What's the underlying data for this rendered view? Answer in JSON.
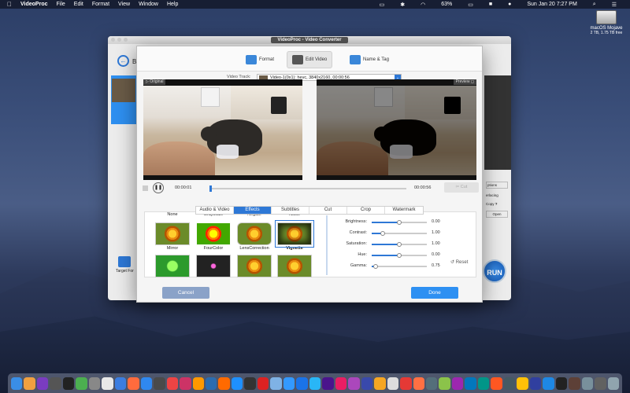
{
  "menubar": {
    "app": "VideoProc",
    "items": [
      "File",
      "Edit",
      "Format",
      "View",
      "Window",
      "Help"
    ],
    "battery": "63%",
    "datetime": "Sun Jan 20  7:27 PM"
  },
  "desktop": {
    "drive_name": "macOS Mojave",
    "drive_info": "2 TB, 1.75 TB free"
  },
  "back_window": {
    "title": "VideoProc - Video Converter",
    "back_letter": "B",
    "options_label": "ptions",
    "deinterlacing": "erlacing",
    "copy_label": "Copy",
    "help": "?",
    "open_label": "Open",
    "run_label": "RUN",
    "target_label": "Target For"
  },
  "dialog": {
    "tabs": [
      "Format",
      "Edit Video",
      "Name & Tag"
    ],
    "video_track_label": "Video Track:",
    "video_track_value": "Video-1(0x1): hevc, 3840x2160, 00:00:56",
    "original_label": "Original",
    "preview_label": "Preview",
    "time_current": "00:00:01",
    "time_total": "00:00:56",
    "cut_label": "Cut",
    "edit_tabs": [
      "Audio & Video",
      "Effects",
      "Subtitles",
      "Cut",
      "Crop",
      "Watermark"
    ],
    "active_edit_tab": "Effects",
    "effects": [
      "None",
      "Grayscale",
      "Negate",
      "Noise",
      "Mirror",
      "FourColor",
      "LensCorrection",
      "Vignette"
    ],
    "selected_effect": "Vignette",
    "adjustments": [
      {
        "label": "Brightness:",
        "value": "0.00",
        "level": 0.5
      },
      {
        "label": "Contrast:",
        "value": "1.00",
        "level": 0.2
      },
      {
        "label": "Saturation:",
        "value": "1.00",
        "level": 0.5
      },
      {
        "label": "Hue:",
        "value": "0.00",
        "level": 0.5
      },
      {
        "label": "Gamma:",
        "value": "0.75",
        "level": 0.07
      }
    ],
    "reset_label": "Reset",
    "cancel_label": "Cancel",
    "done_label": "Done"
  },
  "dock_colors": [
    "#3a8ee6",
    "#f0a040",
    "#7a3cc0",
    "#555",
    "#222",
    "#4caf50",
    "#888",
    "#e8e8e8",
    "#3b7de0",
    "#ff6b3d",
    "#2f88f0",
    "#4a4a4a",
    "#e44",
    "#cc3366",
    "#ff9900",
    "#2b6cb0",
    "#ff6a00",
    "#1e90ff",
    "#333",
    "#dd2222",
    "#7fb2e5",
    "#3399ff",
    "#1a73e8",
    "#29b6f6",
    "#4a148c",
    "#e91e63",
    "#ab47bc",
    "#3949ab",
    "#f5a623",
    "#ddd",
    "#e53935",
    "#ff7043",
    "#546e7a",
    "#8bc34a",
    "#9c27b0",
    "#0277bd",
    "#009688",
    "#ff5722",
    "#455a64",
    "#ffc107",
    "#303f9f",
    "#1e88e5",
    "#222",
    "#5d4037",
    "#78909c",
    "#616161",
    "#90a4ae"
  ]
}
